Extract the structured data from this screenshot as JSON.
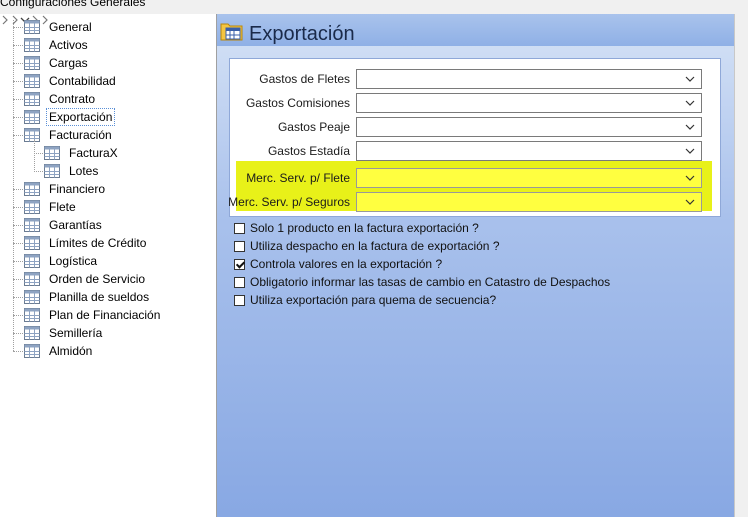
{
  "window": {
    "title": "Configuraciones Generales"
  },
  "tree": {
    "items": [
      {
        "label": "General",
        "has_expander": false,
        "expanded": false,
        "level": 0,
        "selected": false
      },
      {
        "label": "Activos",
        "has_expander": false,
        "expanded": false,
        "level": 0,
        "selected": false
      },
      {
        "label": "Cargas",
        "has_expander": true,
        "expanded": false,
        "level": 0,
        "selected": false
      },
      {
        "label": "Contabilidad",
        "has_expander": true,
        "expanded": false,
        "level": 0,
        "selected": false
      },
      {
        "label": "Contrato",
        "has_expander": false,
        "expanded": false,
        "level": 0,
        "selected": false
      },
      {
        "label": "Exportación",
        "has_expander": false,
        "expanded": false,
        "level": 0,
        "selected": true
      },
      {
        "label": "Facturación",
        "has_expander": true,
        "expanded": true,
        "level": 0,
        "selected": false
      },
      {
        "label": "FacturaX",
        "has_expander": false,
        "expanded": false,
        "level": 1,
        "selected": false
      },
      {
        "label": "Lotes",
        "has_expander": false,
        "expanded": false,
        "level": 1,
        "selected": false
      },
      {
        "label": "Financiero",
        "has_expander": true,
        "expanded": false,
        "level": 0,
        "selected": false
      },
      {
        "label": "Flete",
        "has_expander": false,
        "expanded": false,
        "level": 0,
        "selected": false
      },
      {
        "label": "Garantías",
        "has_expander": false,
        "expanded": false,
        "level": 0,
        "selected": false
      },
      {
        "label": "Límites de Crédito",
        "has_expander": false,
        "expanded": false,
        "level": 0,
        "selected": false
      },
      {
        "label": "Logística",
        "has_expander": false,
        "expanded": false,
        "level": 0,
        "selected": false
      },
      {
        "label": "Orden de Servicio",
        "has_expander": false,
        "expanded": false,
        "level": 0,
        "selected": false
      },
      {
        "label": "Planilla de sueldos",
        "has_expander": true,
        "expanded": false,
        "level": 0,
        "selected": false
      },
      {
        "label": "Plan de Financiación",
        "has_expander": false,
        "expanded": false,
        "level": 0,
        "selected": false
      },
      {
        "label": "Semillería",
        "has_expander": false,
        "expanded": false,
        "level": 0,
        "selected": false
      },
      {
        "label": "Almidón",
        "has_expander": false,
        "expanded": false,
        "level": 0,
        "selected": false
      }
    ]
  },
  "panel": {
    "title": "Exportación",
    "fields": [
      {
        "label": "Gastos de Fletes",
        "value": "",
        "highlighted": false
      },
      {
        "label": "Gastos Comisiones",
        "value": "",
        "highlighted": false
      },
      {
        "label": "Gastos Peaje",
        "value": "",
        "highlighted": false
      },
      {
        "label": "Gastos Estadía",
        "value": "",
        "highlighted": false
      },
      {
        "label": "Merc. Serv. p/ Flete",
        "value": "",
        "highlighted": true
      },
      {
        "label": "Merc. Serv. p/ Seguros",
        "value": "",
        "highlighted": true
      }
    ],
    "checkboxes": [
      {
        "label": "Solo 1 producto en la factura exportación ?",
        "checked": false
      },
      {
        "label": "Utiliza despacho en la factura de exportación ?",
        "checked": false
      },
      {
        "label": "Controla valores en la exportación ?",
        "checked": true
      },
      {
        "label": "Obligatorio informar las tasas de cambio en Catastro de Despachos",
        "checked": false
      },
      {
        "label": "Utiliza exportación para quema de secuencia?",
        "checked": false
      }
    ]
  },
  "colors": {
    "panel_gradient_top": "#d6e3f6",
    "panel_gradient_bottom": "#88a8e3",
    "highlight": "#e6f000",
    "selection_border": "#5a8fd6"
  }
}
